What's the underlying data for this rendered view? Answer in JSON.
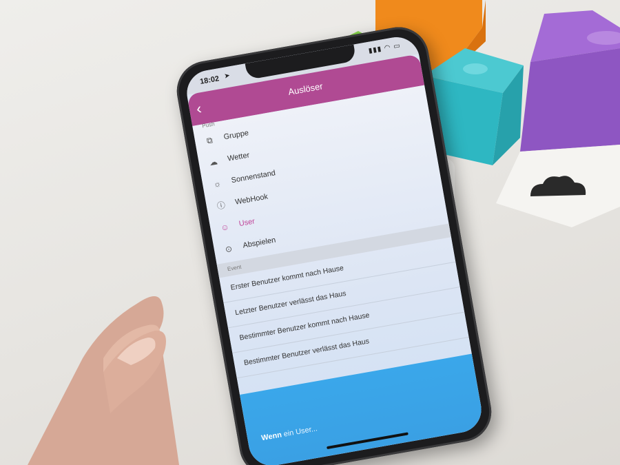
{
  "status_bar": {
    "time": "18:02",
    "location_icon": "location-arrow-icon",
    "right_icons": [
      "signal-icon",
      "wifi-icon",
      "battery-icon"
    ]
  },
  "nav": {
    "back_icon": "chevron-left-icon",
    "title": "Auslöser"
  },
  "partial_header": {
    "label": "Push"
  },
  "trigger_items": [
    {
      "label": "Gruppe",
      "icon": "group-icon"
    },
    {
      "label": "Wetter",
      "icon": "weather-icon"
    },
    {
      "label": "Sonnenstand",
      "icon": "sun-position-icon"
    },
    {
      "label": "WebHook",
      "icon": "webhook-icon"
    },
    {
      "label": "User",
      "icon": "user-icon",
      "active": true
    },
    {
      "label": "Abspielen",
      "icon": "play-circle-icon"
    }
  ],
  "event_section": {
    "label": "Event"
  },
  "events": [
    {
      "label": "Erster Benutzer kommt nach Hause"
    },
    {
      "label": "Letzter Benutzer verlässt das Haus"
    },
    {
      "label": "Bestimmter Benutzer kommt nach Hause"
    },
    {
      "label": "Bestimmter Benutzer verlässt das Haus"
    }
  ],
  "footer": {
    "bold": "Wenn",
    "text": " ein User..."
  },
  "colors": {
    "nav_bar": "#b04a93",
    "active_item": "#c0469a",
    "footer": "#3aa7ea"
  }
}
